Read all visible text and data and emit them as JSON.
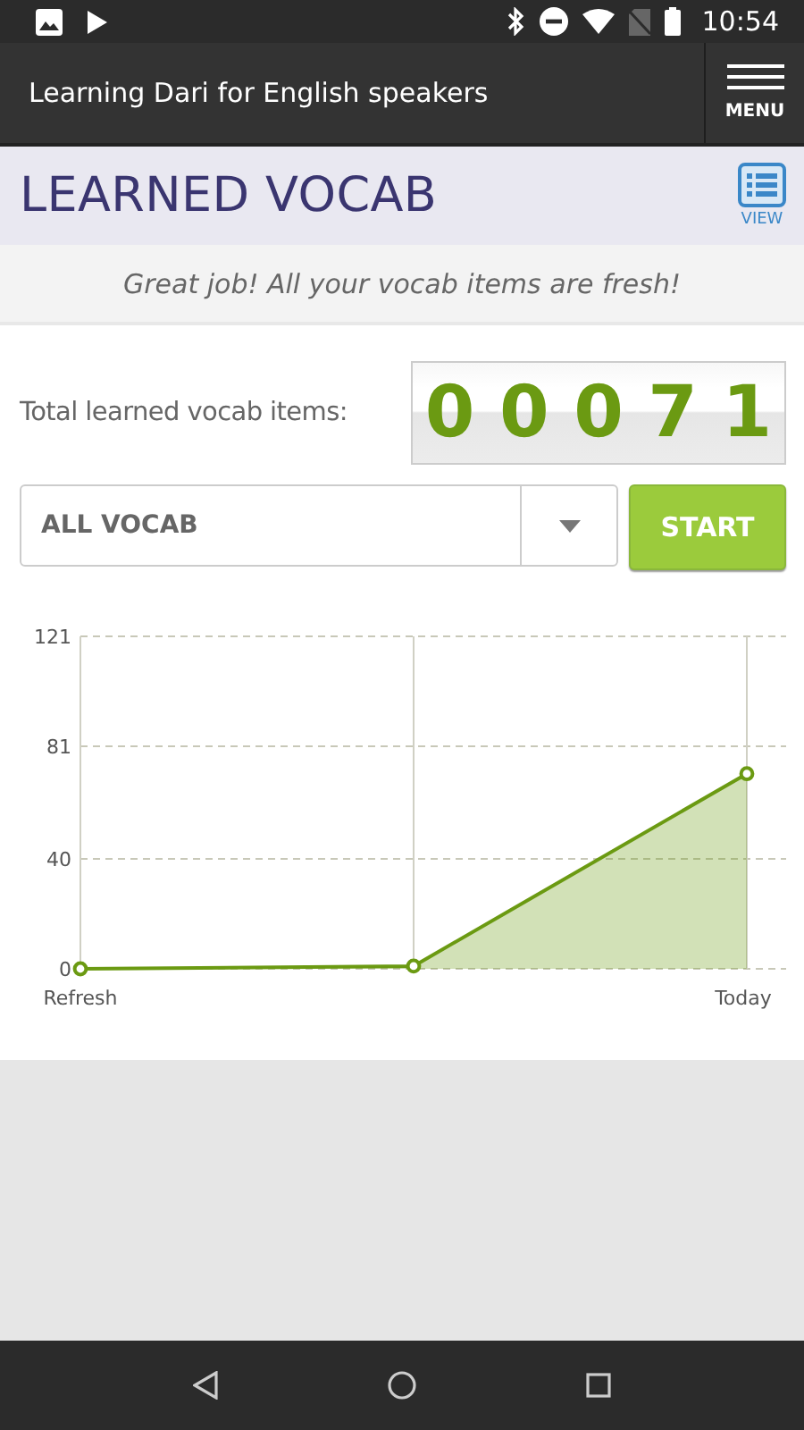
{
  "status_bar": {
    "time": "10:54"
  },
  "app_bar": {
    "title": "Learning Dari for English speakers",
    "menu_label": "MENU"
  },
  "header": {
    "title": "LEARNED VOCAB",
    "view_label": "VIEW"
  },
  "message": "Great job! All your vocab items are fresh!",
  "counter": {
    "label": "Total learned vocab items:",
    "digits": [
      "0",
      "0",
      "0",
      "7",
      "1"
    ]
  },
  "filter": {
    "value": "ALL VOCAB",
    "button": "START"
  },
  "chart_data": {
    "type": "area",
    "categories": [
      "Refresh",
      null,
      "Today"
    ],
    "series": [
      {
        "color": "#6b9a12",
        "values": [
          0,
          1,
          71
        ]
      }
    ],
    "ylim": [
      0,
      121
    ],
    "yticks": [
      0,
      40,
      81,
      121
    ],
    "grid": true
  }
}
